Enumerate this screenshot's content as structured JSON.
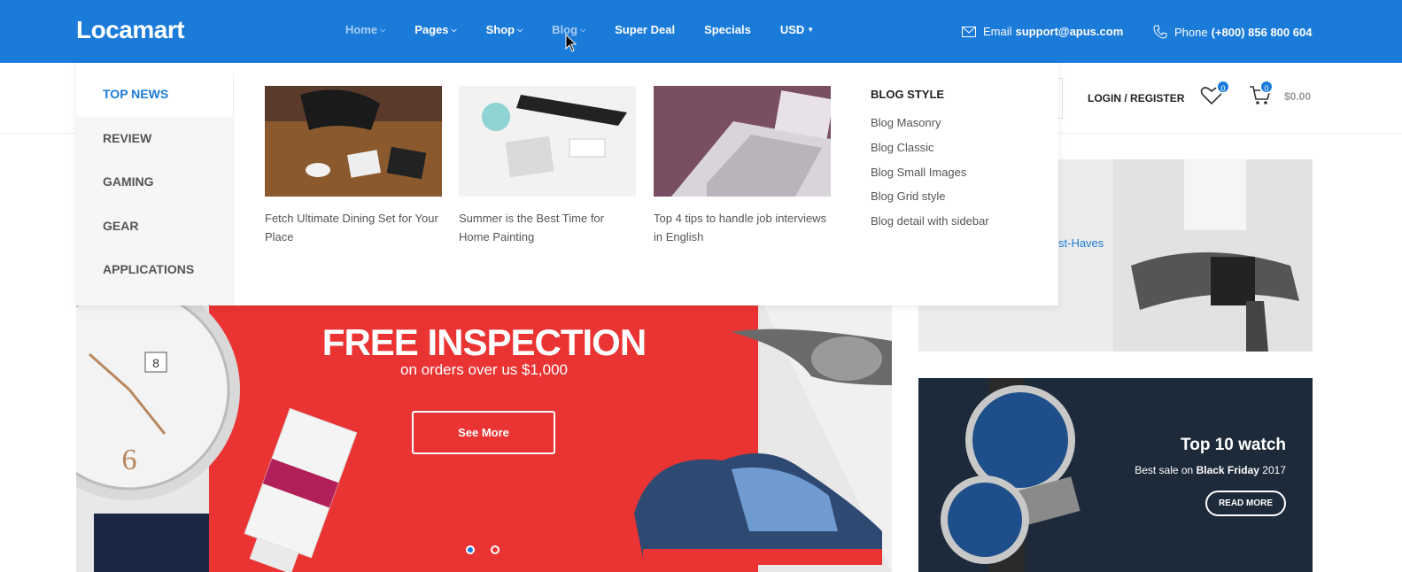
{
  "brand": {
    "logo": "Locamart",
    "accent": "#1b7bd9"
  },
  "nav": [
    {
      "label": "Home",
      "caret": true
    },
    {
      "label": "Pages",
      "caret": true
    },
    {
      "label": "Shop",
      "caret": true
    },
    {
      "label": "Blog",
      "caret": true
    },
    {
      "label": "Super Deal",
      "caret": false
    },
    {
      "label": "Specials",
      "caret": false
    },
    {
      "label": "USD",
      "caret": true
    }
  ],
  "contact": {
    "email_label": "Email",
    "email_value": "support@apus.com",
    "phone_label": "Phone",
    "phone_value": "(+800) 856 800 604"
  },
  "account": {
    "login": "LOGIN",
    "separator": "/",
    "register": "REGISTER",
    "wishlist_count": "0",
    "cart_count": "0",
    "cart_total": "$0.00"
  },
  "mega_menu": {
    "categories": [
      "TOP NEWS",
      "REVIEW",
      "GAMING",
      "GEAR",
      "APPLICATIONS"
    ],
    "posts": [
      {
        "title": "Fetch Ultimate Dining Set for Your Place"
      },
      {
        "title": "Summer is the Best Time for Home Painting"
      },
      {
        "title": "Top 4 tips to handle job interviews in English"
      }
    ],
    "blog_style": {
      "heading": "BLOG STYLE",
      "links": [
        "Blog Masonry",
        "Blog Classic",
        "Blog Small Images",
        "Blog Grid style",
        "Blog detail with sidebar"
      ]
    }
  },
  "hero": {
    "title": "FREE INSPECTION",
    "subtitle": "on orders over us $1,000",
    "button": "See More"
  },
  "side_banner_1": {
    "text": "st-Haves"
  },
  "side_banner_2": {
    "title": "Top 10 watch",
    "sub_pre": "Best sale on",
    "sub_bold": "Black Friday",
    "sub_post": "2017",
    "button": "READ MORE"
  }
}
